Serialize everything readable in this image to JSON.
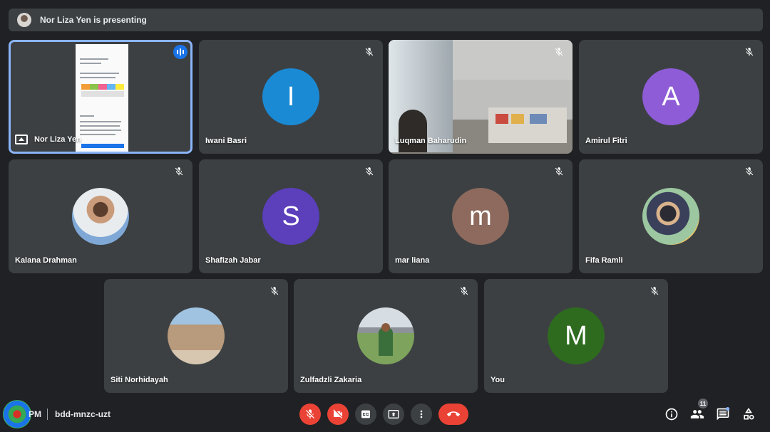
{
  "banner": {
    "text": "Nor Liza Yen is presenting"
  },
  "tiles": [
    {
      "name": "Nor Liza Yen",
      "type": "presentation"
    },
    {
      "name": "Iwani Basri",
      "initial": "I",
      "color": "#1a8ad4"
    },
    {
      "name": "Luqman Baharudin",
      "type": "video"
    },
    {
      "name": "Amirul Fitri",
      "initial": "A",
      "color": "#8e5cd6"
    },
    {
      "name": "Kalana Drahman",
      "type": "photo"
    },
    {
      "name": "Shafizah Jabar",
      "initial": "S",
      "color": "#5b3fbb"
    },
    {
      "name": "mar liana",
      "initial": "m",
      "color": "#8d6a5d"
    },
    {
      "name": "Fifa Ramli",
      "type": "photo"
    },
    {
      "name": "Siti Norhidayah",
      "type": "photo"
    },
    {
      "name": "Zulfadzli Zakaria",
      "type": "photo"
    },
    {
      "name": "You",
      "initial": "M",
      "color": "#2e6b1f"
    }
  ],
  "bottombar": {
    "time": "PM",
    "meeting_code": "bdd-mnzc-uzt",
    "participant_count": "11"
  },
  "icons": {
    "mute": "mic-off-icon",
    "camera": "videocam-off-icon",
    "captions": "closed-caption-icon",
    "present": "present-to-all-icon",
    "more": "more-vert-icon",
    "end": "call-end-icon",
    "info": "info-icon",
    "people": "people-icon",
    "chat": "chat-icon",
    "activities": "activities-icon"
  },
  "colors": {
    "background": "#202124",
    "tile": "#3c4043",
    "active_border": "#8ab4f8",
    "danger": "#ea4335"
  }
}
